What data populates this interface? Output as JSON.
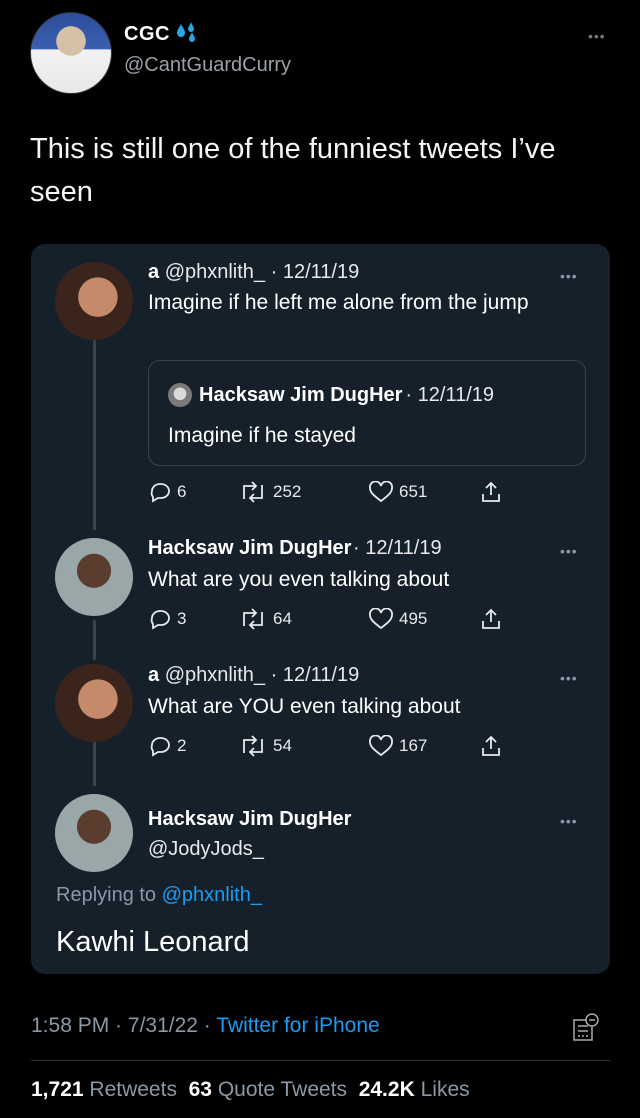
{
  "author": {
    "name": "CGC",
    "handle": "@CantGuardCurry"
  },
  "tweet": {
    "text": "This is still one of the funniest tweets I’ve seen"
  },
  "embedded_thread": [
    {
      "name": "a",
      "handle": "@phxnlith_",
      "date": "12/11/19",
      "text": "Imagine if he left me alone from the jump",
      "quote": {
        "name": "Hacksaw Jim DugHer",
        "date": "12/11/19",
        "text": "Imagine if he stayed"
      },
      "replies": "6",
      "retweets": "252",
      "likes": "651"
    },
    {
      "name": "Hacksaw Jim DugHer",
      "date": "12/11/19",
      "text": "What are you even talking about",
      "replies": "3",
      "retweets": "64",
      "likes": "495"
    },
    {
      "name": "a",
      "handle": "@phxnlith_",
      "date": "12/11/19",
      "text": "What are YOU even talking about",
      "replies": "2",
      "retweets": "54",
      "likes": "167"
    },
    {
      "name": "Hacksaw Jim DugHer",
      "handle": "@JodyJods_",
      "replying_label": "Replying to",
      "replying_to": "@phxnlith_",
      "text": "Kawhi Leonard"
    }
  ],
  "footer": {
    "time": "1:58 PM",
    "date": "7/31/22",
    "source": "Twitter for iPhone",
    "separator": " · "
  },
  "stats": {
    "retweets_count": "1,721",
    "retweets_label": "Retweets",
    "quotes_count": "63",
    "quotes_label": "Quote Tweets",
    "likes_count": "24.2K",
    "likes_label": "Likes"
  },
  "more_glyph": "•••",
  "colors": {
    "background": "#000000",
    "card": "#15202b",
    "link": "#1d9bf0",
    "muted": "#8b98a5"
  }
}
